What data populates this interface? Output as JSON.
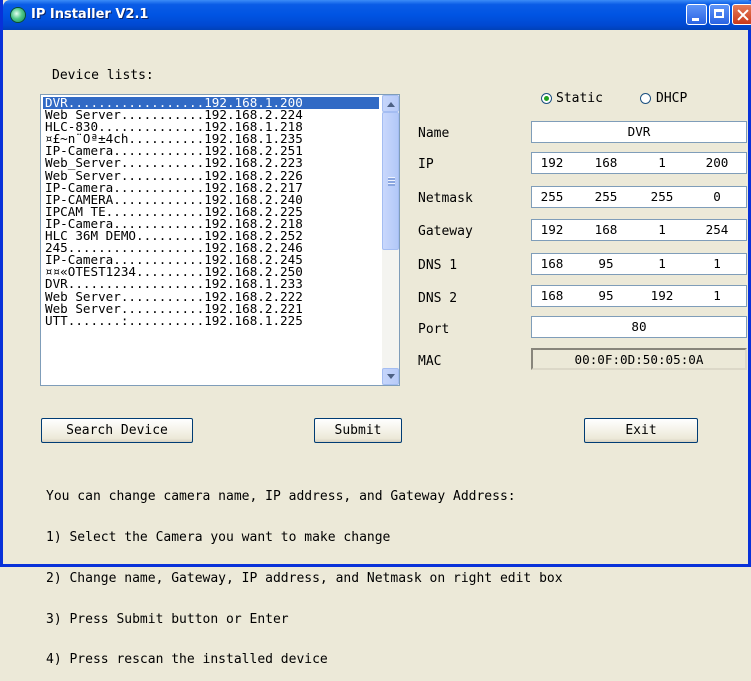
{
  "window": {
    "title": "IP Installer V2.1"
  },
  "device_list": {
    "label": "Device lists:",
    "items": [
      "DVR..................192.168.1.200",
      "Web_Server...........192.168.2.224",
      "HLC-830..............192.168.1.218",
      "¤£~n¨Ôª±4ch..........192.168.1.235",
      "IP-Camera............192.168.2.251",
      "Web_Server...........192.168.2.223",
      "Web_Server...........192.168.2.226",
      "IP-Camera............192.168.2.217",
      "IP-CAMERA............192.168.2.240",
      "IPCAM_TE.............192.168.2.225",
      "IP-Camera............192.168.2.218",
      "HLC_36M_DEMO.........192.168.2.252",
      "245..................192.168.2.246",
      "IP-Camera............192.168.2.245",
      "¤¤«OTEST1234.........192.168.2.250",
      "DVR..................192.168.1.233",
      "Web_Server...........192.168.2.222",
      "Web_Server...........192.168.2.221",
      "UTT.......:..........192.168.1.225"
    ],
    "selected_index": 0
  },
  "mode": {
    "static_label": "Static",
    "dhcp_label": "DHCP",
    "selected": "Static"
  },
  "fields": {
    "name": {
      "label": "Name",
      "value": "DVR"
    },
    "ip": {
      "label": "IP",
      "octets": [
        "192",
        "168",
        "1",
        "200"
      ]
    },
    "netmask": {
      "label": "Netmask",
      "octets": [
        "255",
        "255",
        "255",
        "0"
      ]
    },
    "gateway": {
      "label": "Gateway",
      "octets": [
        "192",
        "168",
        "1",
        "254"
      ]
    },
    "dns1": {
      "label": "DNS 1",
      "octets": [
        "168",
        "95",
        "1",
        "1"
      ]
    },
    "dns2": {
      "label": "DNS 2",
      "octets": [
        "168",
        "95",
        "192",
        "1"
      ]
    },
    "port": {
      "label": "Port",
      "value": "80"
    },
    "mac": {
      "label": "MAC",
      "value": "00:0F:0D:50:05:0A"
    }
  },
  "buttons": {
    "search": "Search Device",
    "submit": "Submit",
    "exit": "Exit"
  },
  "instructions": [
    "You can change camera name, IP address, and Gateway Address:",
    "1) Select the Camera you want to make change",
    "2) Change name, Gateway, IP address, and Netmask on right edit box",
    "3) Press Submit button or Enter",
    "4) Press rescan the installed device"
  ]
}
